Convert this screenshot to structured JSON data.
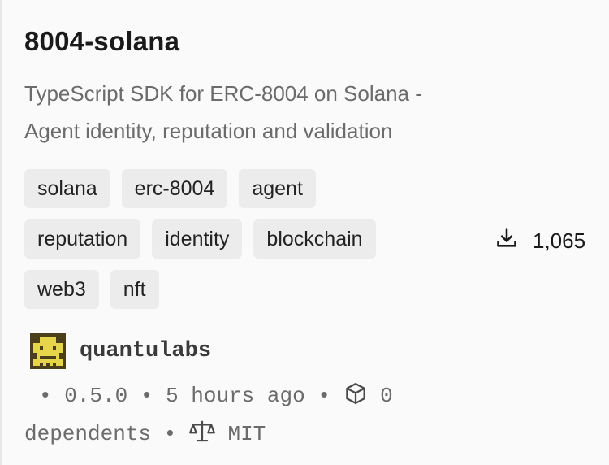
{
  "package": {
    "name": "8004-solana",
    "description_line1": "TypeScript SDK for ERC-8004 on Solana -",
    "description_line2": "Agent identity, reputation and validation",
    "tags_row1": [
      "solana",
      "erc-8004",
      "agent"
    ],
    "tags_row2": [
      "reputation",
      "identity",
      "blockchain"
    ],
    "tags_row3": [
      "web3",
      "nft"
    ],
    "downloads": "1,065",
    "author": "quantulabs",
    "version": "0.5.0",
    "updated": "5 hours ago",
    "dependents_count": "0",
    "dependents_label": "dependents",
    "license": "MIT",
    "separator": "•"
  },
  "icons": {
    "downloads": "download-icon",
    "dependents": "package-box-icon",
    "license": "scale-icon",
    "avatar": "pixel-avatar-icon"
  },
  "colors": {
    "background": "#fafafa",
    "tag_background": "#ececec",
    "muted_text": "#6b6b6b",
    "avatar_yellow": "#e6d44a",
    "avatar_dark": "#4a3f1a"
  }
}
